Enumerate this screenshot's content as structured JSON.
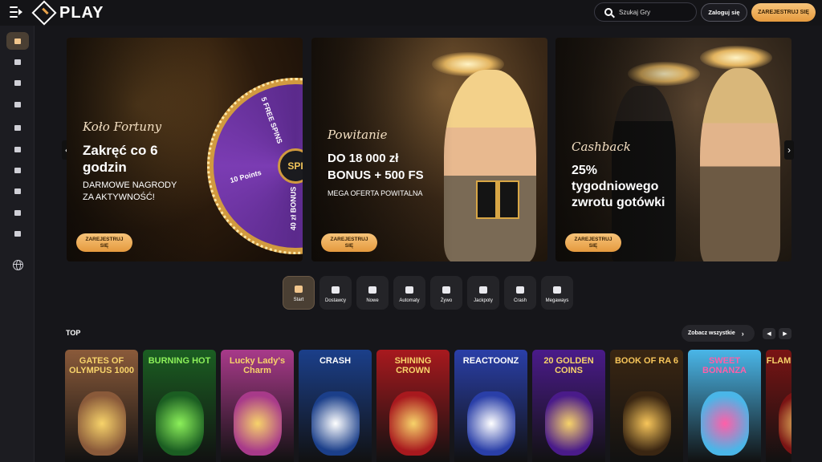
{
  "header": {
    "logo": "PLAY",
    "search_placeholder": "Szukaj Gry",
    "login_label": "Zaloguj się",
    "register_label": "ZAREJESTRUJ SIĘ"
  },
  "sidebar": {
    "items": [
      {
        "icon": "home-icon",
        "active": true
      },
      {
        "icon": "rocket-icon",
        "active": false
      },
      {
        "icon": "dice-icon",
        "active": false
      },
      {
        "icon": "live-cards-icon",
        "active": false
      },
      {
        "icon": "slot-machine-icon",
        "active": false
      },
      {
        "icon": "roulette-icon",
        "active": false
      },
      {
        "icon": "crown-icon",
        "active": false
      },
      {
        "icon": "gift-icon",
        "active": false
      },
      {
        "icon": "trophy-icon",
        "active": false
      },
      {
        "icon": "wallet-icon",
        "active": false
      },
      {
        "icon": "globe-icon",
        "active": false
      }
    ]
  },
  "banners": [
    {
      "script": "Koło Fortuny",
      "headline": [
        "Zakręć co 6",
        "godzin"
      ],
      "subline": [
        "DARMOWE NAGRODY",
        "ZA AKTYWNOŚĆ!"
      ],
      "cta": [
        "ZAREJESTRUJ",
        "SIĘ"
      ],
      "wheel": {
        "hub": "SPI",
        "labels": [
          "5 FREE SPINS",
          "10 Points",
          "40 zł BONUS"
        ]
      }
    },
    {
      "script": "Powitanie",
      "headline": [
        "DO 18 000 zł",
        "BONUS + 500 FS"
      ],
      "subline": [
        "MEGA OFERTA POWITALNA"
      ],
      "cta": [
        "ZAREJESTRUJ",
        "SIĘ"
      ]
    },
    {
      "script": "Cashback",
      "headline": [
        "25%",
        "tygodniowego",
        "zwrotu gotówki"
      ],
      "subline": [],
      "cta": [
        "ZAREJESTRUJ",
        "SIĘ"
      ]
    }
  ],
  "categories": [
    {
      "label": "Start",
      "icon": "start-icon",
      "active": true
    },
    {
      "label": "Dostawcy",
      "icon": "provider-icon",
      "active": false
    },
    {
      "label": "Nowe",
      "icon": "new-badge-icon",
      "active": false
    },
    {
      "label": "Automaty",
      "icon": "cherries-icon",
      "active": false
    },
    {
      "label": "Żywo",
      "icon": "cards-icon",
      "active": false
    },
    {
      "label": "Jackpoty",
      "icon": "clover-icon",
      "active": false
    },
    {
      "label": "Crash",
      "icon": "rocket-icon",
      "active": false
    },
    {
      "label": "Megaways",
      "icon": "megaways-icon",
      "active": false
    }
  ],
  "top": {
    "title": "TOP",
    "see_all": "Zobacz wszystkie",
    "games": [
      {
        "name": "GATES OF OLYMPUS 1000",
        "bg": "#8a5a3a",
        "fg": "#f7d36a"
      },
      {
        "name": "BURNING HOT",
        "bg": "#1b5e22",
        "fg": "#8cf05a"
      },
      {
        "name": "Lucky Lady's Charm",
        "bg": "#a83a8a",
        "fg": "#f7d36a"
      },
      {
        "name": "CRASH",
        "bg": "#1b3f8a",
        "fg": "#ffffff"
      },
      {
        "name": "SHINING CROWN",
        "bg": "#a8191e",
        "fg": "#f7d36a"
      },
      {
        "name": "REACTOONZ",
        "bg": "#2a3fa8",
        "fg": "#ffffff"
      },
      {
        "name": "20 GOLDEN COINS",
        "bg": "#4a1b8a",
        "fg": "#f7d36a"
      },
      {
        "name": "BOOK OF RA 6",
        "bg": "#3a2612",
        "fg": "#f7c55a"
      },
      {
        "name": "SWEET BONANZA",
        "bg": "#4ab6e8",
        "fg": "#ff5fa8"
      },
      {
        "name": "FLAM",
        "bg": "#7a1414",
        "fg": "#f7d36a"
      }
    ]
  }
}
